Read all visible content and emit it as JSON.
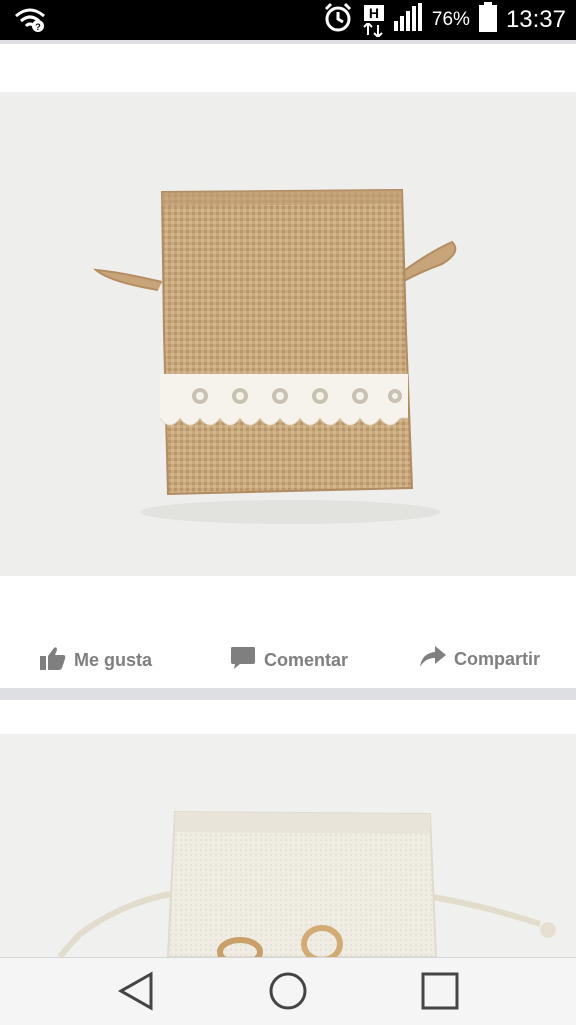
{
  "status_bar": {
    "battery_percent": "76%",
    "time": "13:37",
    "network_badge": "H",
    "icons": [
      "wifi-icon",
      "alarm-icon",
      "network-icon",
      "signal-icon",
      "battery-icon"
    ]
  },
  "post": {
    "photo": "burlap-bag-with-lace",
    "actions": {
      "like": "Me gusta",
      "comment": "Comentar",
      "share": "Compartir"
    }
  },
  "next_post": {
    "photo": "linen-bag-with-rings"
  },
  "nav_bar": {
    "icons": [
      "back-icon",
      "home-icon",
      "recents-icon"
    ]
  },
  "colors": {
    "action_text": "#7f7f7f",
    "separator": "#dddfe2",
    "burlap": "#c9a97e"
  }
}
